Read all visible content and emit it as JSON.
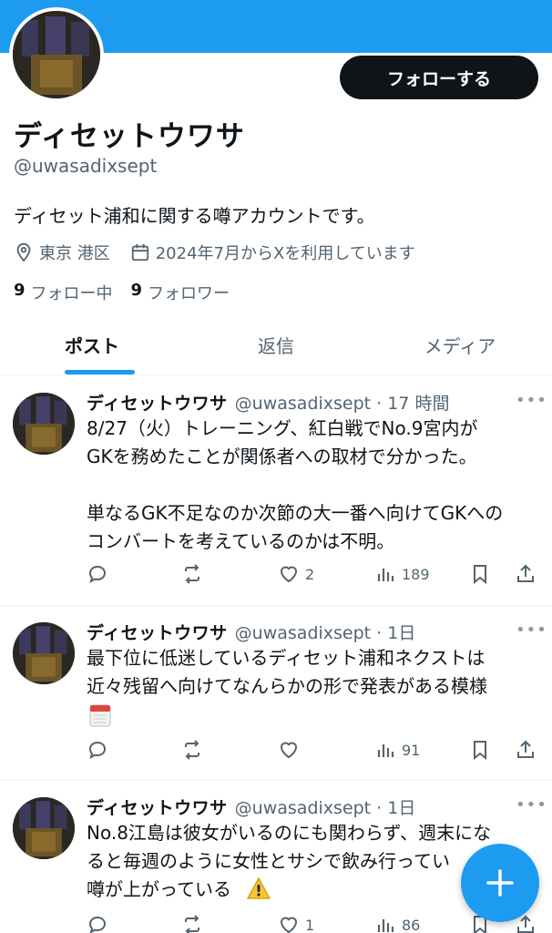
{
  "profile": {
    "follow_label": "フォローする",
    "display_name": "ディセットウワサ",
    "handle": "@uwasadixsept",
    "bio": "ディセット浦和に関する噂アカウントです。",
    "location": "東京 港区",
    "joined": "2024年7月からXを利用しています",
    "following_count": "9",
    "following_label": "フォロー中",
    "followers_count": "9",
    "followers_label": "フォロワー"
  },
  "tabs": [
    "ポスト",
    "返信",
    "メディア"
  ],
  "posts": [
    {
      "name": "ディセットウワサ",
      "meta": "@uwasadixsept · 17 時間",
      "text": "8/27（火）トレーニング、紅白戦でNo.9宮内が\nGKを務めたことが関係者への取材で分かった。\n\n単なるGK不足なのか次節の大一番へ向けてGKへの\nコンバートを考えているのかは不明。",
      "likes": "2",
      "views": "189"
    },
    {
      "name": "ディセットウワサ",
      "meta": "@uwasadixsept · 1日",
      "text": "最下位に低迷しているディセット浦和ネクストは\n近々残留へ向けてなんらかの形で発表がある模様",
      "likes": "",
      "views": "91"
    },
    {
      "name": "ディセットウワサ",
      "meta": "@uwasadixsept · 1日",
      "text": "No.8江島は彼女がいるのにも関わらず、週末にな\nると毎週のように女性とサシで飲み行ってい\n噂が上がっている",
      "likes": "1",
      "views": "86"
    }
  ],
  "icons": {
    "more": "more-icon",
    "reply": "reply-icon",
    "repost": "repost-icon",
    "like": "heart-icon",
    "views": "views-icon",
    "bookmark": "bookmark-icon",
    "share": "share-icon",
    "compose": "compose-icon"
  },
  "colors": {
    "accent": "#1d9bf0",
    "text": "#0f1419",
    "muted": "#536471",
    "button": "#0f1419"
  }
}
